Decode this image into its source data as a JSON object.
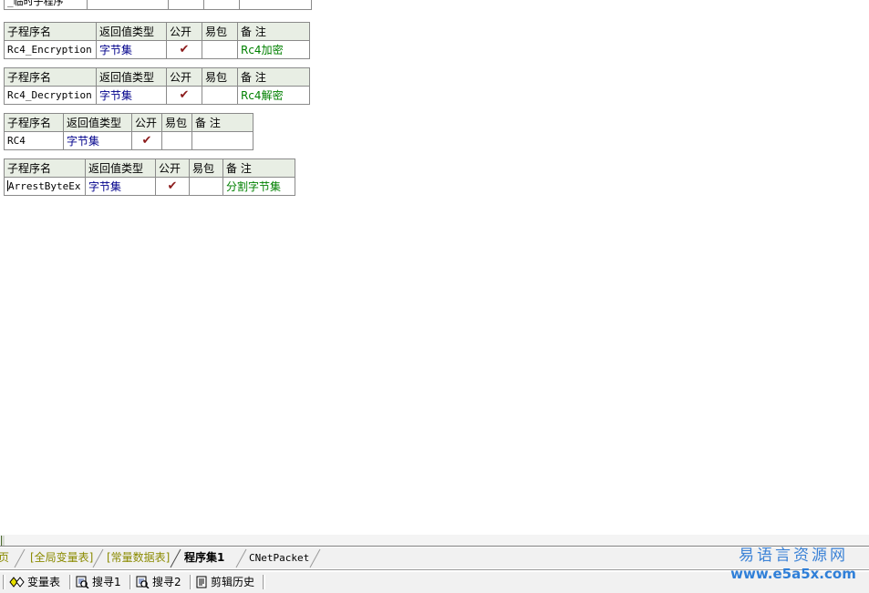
{
  "editor": {
    "clipped_table": {
      "name": "_临时子程序",
      "cols": [
        "",
        "",
        "",
        ""
      ]
    },
    "columns": {
      "name": "子程序名",
      "return_type": "返回值类型",
      "public": "公开",
      "easy_pack": "易包",
      "remark": "备 注"
    },
    "check_glyph": "✔",
    "tables": [
      {
        "name": "Rc4_Encryption",
        "return_type": "字节集",
        "public": true,
        "easy_pack": "",
        "remark": "Rc4加密"
      },
      {
        "name": "Rc4_Decryption",
        "return_type": "字节集",
        "public": true,
        "easy_pack": "",
        "remark": "Rc4解密"
      },
      {
        "name": "RC4",
        "return_type": "字节集",
        "public": true,
        "easy_pack": "",
        "remark": ""
      },
      {
        "name": "ArrestByteEx",
        "return_type": "字节集",
        "public": true,
        "easy_pack": "",
        "remark": "分割字节集"
      }
    ]
  },
  "tabs": [
    {
      "label": "页",
      "style": "olive"
    },
    {
      "label": "[全局变量表]",
      "style": "olive"
    },
    {
      "label": "[常量数据表]",
      "style": "olive"
    },
    {
      "label": "程序集1",
      "style": "active"
    },
    {
      "label": "CNetPacket",
      "style": "mono"
    }
  ],
  "toolbar": [
    {
      "label": "变量表",
      "icon": "diamonds-icon"
    },
    {
      "label": "搜寻1",
      "icon": "magnifier-page-icon"
    },
    {
      "label": "搜寻2",
      "icon": "magnifier-page-icon"
    },
    {
      "label": "剪辑历史",
      "icon": "clipboard-icon"
    }
  ],
  "watermark": {
    "cn": "易语言资源网",
    "url": "www.e5a5x.com"
  },
  "colors": {
    "header_bg": "#e8eee4",
    "type_text": "#00008B",
    "remark_text": "#008000",
    "check_mark": "#8b1a1a",
    "tab_olive": "#8a8a00",
    "watermark": "#2f7fd8"
  }
}
